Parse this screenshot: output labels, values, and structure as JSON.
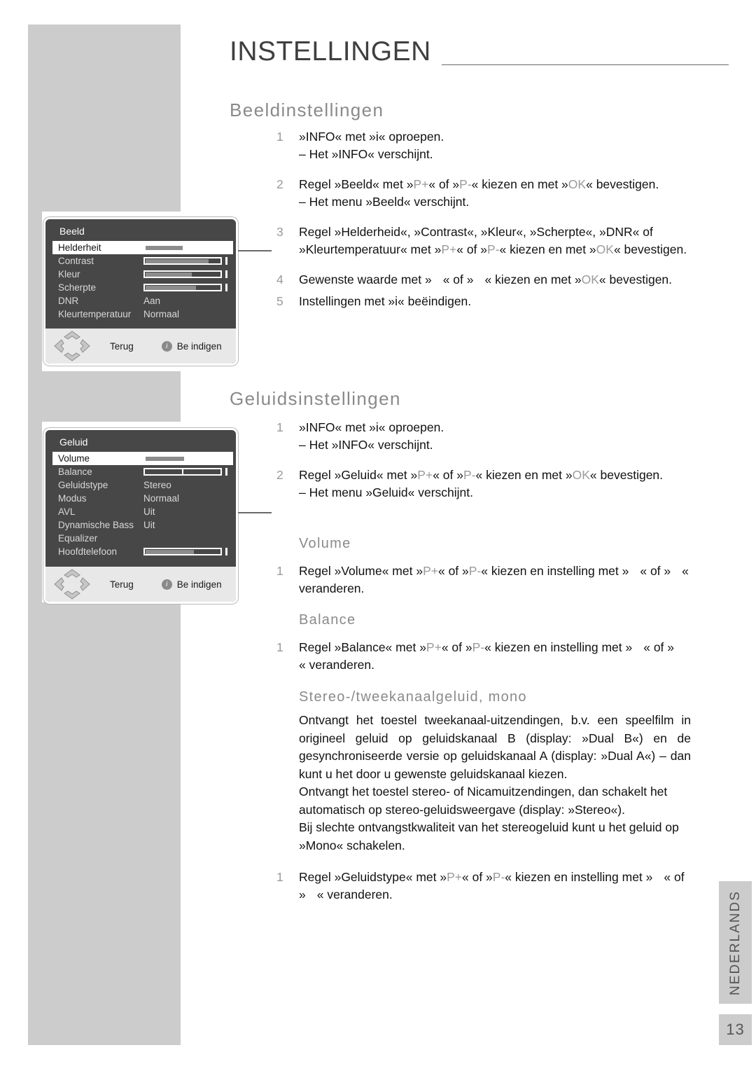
{
  "page": {
    "title": "INSTELLINGEN",
    "number": "13",
    "language_tab": "NEDERLANDS"
  },
  "sections": [
    {
      "id": "beeld",
      "heading": "Beeldinstellingen",
      "steps": [
        {
          "num": "1",
          "parts": [
            {
              "t": "»INFO« met »i« oproepen.",
              "k": false
            }
          ],
          "sub": "– Het »INFO« verschijnt."
        },
        {
          "num": "2",
          "parts": [
            {
              "t": "Regel »Beeld« met »",
              "k": false
            },
            {
              "t": "P+",
              "k": true
            },
            {
              "t": "« of »",
              "k": false
            },
            {
              "t": "P-",
              "k": true
            },
            {
              "t": "« kiezen en met »",
              "k": false
            },
            {
              "t": "OK",
              "k": true
            },
            {
              "t": "« bevestigen.",
              "k": false
            }
          ],
          "sub": "– Het menu »Beeld« verschijnt."
        },
        {
          "num": "3",
          "parts": [
            {
              "t": "Regel »Helderheid«, »Contrast«, »Kleur«, »Scherpte«, »DNR« of »Kleurtemperatuur« met »",
              "k": false
            },
            {
              "t": "P+",
              "k": true
            },
            {
              "t": "« of »",
              "k": false
            },
            {
              "t": "P-",
              "k": true
            },
            {
              "t": "« kiezen en met »",
              "k": false
            },
            {
              "t": "OK",
              "k": true
            },
            {
              "t": "« bevestigen.",
              "k": false
            }
          ],
          "sub": ""
        },
        {
          "num": "4",
          "parts": [
            {
              "t": "Gewenste waarde met »",
              "k": false
            },
            {
              "t": "ARROWGAP",
              "k": false
            },
            {
              "t": "« of »",
              "k": false
            },
            {
              "t": "ARROWGAP",
              "k": false
            },
            {
              "t": "« kiezen en met »",
              "k": false
            },
            {
              "t": "OK",
              "k": true
            },
            {
              "t": "« bevestigen.",
              "k": false
            }
          ],
          "sub": ""
        },
        {
          "num": "5",
          "parts": [
            {
              "t": "Instellingen met »i« beëindigen.",
              "k": false
            }
          ],
          "sub": ""
        }
      ]
    },
    {
      "id": "geluid",
      "heading": "Geluidsinstellingen",
      "steps": [
        {
          "num": "1",
          "parts": [
            {
              "t": "»INFO« met »i« oproepen.",
              "k": false
            }
          ],
          "sub": "– Het »INFO« verschijnt."
        },
        {
          "num": "2",
          "parts": [
            {
              "t": "Regel »Geluid« met »",
              "k": false
            },
            {
              "t": "P+",
              "k": true
            },
            {
              "t": "« of »",
              "k": false
            },
            {
              "t": "P-",
              "k": true
            },
            {
              "t": "« kiezen en met »",
              "k": false
            },
            {
              "t": "OK",
              "k": true
            },
            {
              "t": "« bevestigen.",
              "k": false
            }
          ],
          "sub": "– Het menu »Geluid« verschijnt."
        }
      ]
    }
  ],
  "sub_sections": [
    {
      "id": "volume",
      "heading": "Volume",
      "steps": [
        {
          "num": "1",
          "parts": [
            {
              "t": "Regel »Volume« met »",
              "k": false
            },
            {
              "t": "P+",
              "k": true
            },
            {
              "t": "« of »",
              "k": false
            },
            {
              "t": "P-",
              "k": true
            },
            {
              "t": "« kiezen en instelling met »",
              "k": false
            },
            {
              "t": "ARROWGAP",
              "k": false
            },
            {
              "t": "« of »",
              "k": false
            },
            {
              "t": "ARROWGAP",
              "k": false
            },
            {
              "t": "« veranderen.",
              "k": false
            }
          ],
          "sub": ""
        }
      ]
    },
    {
      "id": "balance",
      "heading": "Balance",
      "steps": [
        {
          "num": "1",
          "parts": [
            {
              "t": "Regel »Balance« met »",
              "k": false
            },
            {
              "t": "P+",
              "k": true
            },
            {
              "t": "« of »",
              "k": false
            },
            {
              "t": "P-",
              "k": true
            },
            {
              "t": "« kiezen en instelling met »",
              "k": false
            },
            {
              "t": "ARROWGAP",
              "k": false
            },
            {
              "t": "« of »",
              "k": false
            },
            {
              "t": "ARROWGAP",
              "k": false
            },
            {
              "t": "« veranderen.",
              "k": false
            }
          ],
          "sub": ""
        }
      ]
    },
    {
      "id": "stereo",
      "heading": "Stereo-/tweekanaalgeluid, mono",
      "paragraphs": [
        "Ontvangt het toestel tweekanaal-uitzendingen, b.v. een speelfilm in origineel geluid op geluidskanaal B (display: »Dual B«) en de gesynchroniseerde versie op geluidskanaal A (display: »Dual A«) – dan kunt u het door u gewenste geluidskanaal kiezen.",
        "Ontvangt het toestel stereo- of Nicamuitzendingen, dan schakelt het automatisch op stereo-geluidsweergave (display: »Stereo«).",
        "Bij slechte ontvangstkwaliteit van het stereogeluid kunt u het geluid op »Mono« schakelen."
      ],
      "steps": [
        {
          "num": "1",
          "parts": [
            {
              "t": "Regel »Geluidstype« met »",
              "k": false
            },
            {
              "t": "P+",
              "k": true
            },
            {
              "t": "« of »",
              "k": false
            },
            {
              "t": "P-",
              "k": true
            },
            {
              "t": "« kiezen en instelling met »",
              "k": false
            },
            {
              "t": "ARROWGAP",
              "k": false
            },
            {
              "t": "« of »",
              "k": false
            },
            {
              "t": "ARROWGAP",
              "k": false
            },
            {
              "t": "« veranderen.",
              "k": false
            }
          ],
          "sub": ""
        }
      ]
    }
  ],
  "osd_menus": [
    {
      "id": "beeld",
      "title": "Beeld",
      "rows": [
        {
          "label": "Helderheit",
          "type": "slider",
          "fill": 50,
          "selected": true
        },
        {
          "label": "Contrast",
          "type": "slider",
          "fill": 85,
          "selected": false
        },
        {
          "label": "Kleur",
          "type": "slider",
          "fill": 62,
          "selected": false
        },
        {
          "label": "Scherpte",
          "type": "slider",
          "fill": 68,
          "selected": false
        },
        {
          "label": "DNR",
          "type": "value",
          "value": "Aan",
          "selected": false
        },
        {
          "label": "Kleurtemperatuur",
          "type": "value",
          "value": "Normaal",
          "selected": false
        }
      ],
      "footer": {
        "back_label": "Terug",
        "confirm_label": "Be indigen",
        "info_glyph": "i"
      }
    },
    {
      "id": "geluid",
      "title": "Geluid",
      "rows": [
        {
          "label": "Volume",
          "type": "slider",
          "fill": 52,
          "selected": true
        },
        {
          "label": "Balance",
          "type": "center-slider",
          "fill": 0,
          "selected": false
        },
        {
          "label": "Geluidstype",
          "type": "value",
          "value": "Stereo",
          "selected": false
        },
        {
          "label": "Modus",
          "type": "value",
          "value": "Normaal",
          "selected": false
        },
        {
          "label": "AVL",
          "type": "value",
          "value": "Uit",
          "selected": false
        },
        {
          "label": "Dynamische Bass",
          "type": "value",
          "value": "Uit",
          "selected": false
        },
        {
          "label": "Equalizer",
          "type": "value",
          "value": "",
          "selected": false
        },
        {
          "label": "Hoofdtelefoon",
          "type": "slider",
          "fill": 65,
          "selected": false
        }
      ],
      "footer": {
        "back_label": "Terug",
        "confirm_label": "Be indigen",
        "info_glyph": "i"
      }
    }
  ],
  "colors": {
    "gray_panel": "#cccccc",
    "heading_gray": "#8a8a8a",
    "key_gray": "#9a9a9a",
    "osd_background": "#474747",
    "osd_footer": "#e8e8e8"
  }
}
